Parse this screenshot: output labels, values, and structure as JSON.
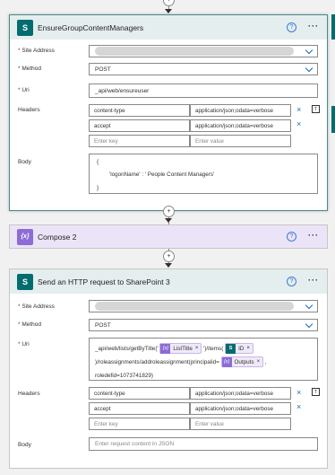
{
  "card1": {
    "title": "EnsureGroupContentManagers",
    "icon": "sharepoint-icon",
    "site_address_label": "Site Address",
    "method_label": "Method",
    "method_value": "POST",
    "uri_label": "Uri",
    "uri_value": "_api/web/ensureuser",
    "headers_label": "Headers",
    "headers": [
      {
        "key": "content-type",
        "value": "application/json;odata=verbose"
      },
      {
        "key": "accept",
        "value": "application/json;odata=verbose"
      }
    ],
    "enter_key_placeholder": "Enter key",
    "enter_value_placeholder": "Enter value",
    "body_label": "Body",
    "body_lines": [
      "{",
      "'logonName' : '  People Content Managers'",
      "}"
    ]
  },
  "card2": {
    "title": "Compose 2",
    "icon": "compose-icon"
  },
  "card3": {
    "title": "Send an HTTP request to SharePoint 3",
    "icon": "sharepoint-icon",
    "site_address_label": "Site Address",
    "method_label": "Method",
    "method_value": "POST",
    "uri_label": "Uri",
    "uri_parts": {
      "p1": "_api/web/lists/getByTitle('",
      "t1": "ListTitle",
      "p2": "')/items(",
      "t2": "ID",
      "p3": ")/roleassignments/addroleassignment(principalid=",
      "t3": "Outputs",
      "p4": ",",
      "p5": "roledefid=1073741829)"
    },
    "headers_label": "Headers",
    "headers": [
      {
        "key": "content-type",
        "value": "application/json;odata=verbose"
      },
      {
        "key": "accept",
        "value": "application/json;odata=verbose"
      }
    ],
    "enter_key_placeholder": "Enter key",
    "enter_value_placeholder": "Enter value",
    "body_label": "Body",
    "body_placeholder": "Enter request content in JSON"
  },
  "common": {
    "help_glyph": "?",
    "more_glyph": "···",
    "required_mark": "*",
    "remove_glyph": "×",
    "plus_glyph": "+",
    "sp_glyph": "S",
    "compose_glyph": "{x}"
  },
  "colors": {
    "sharepoint": "#036c70",
    "compose": "#8c6cd6",
    "accent": "#0f6cbd"
  }
}
